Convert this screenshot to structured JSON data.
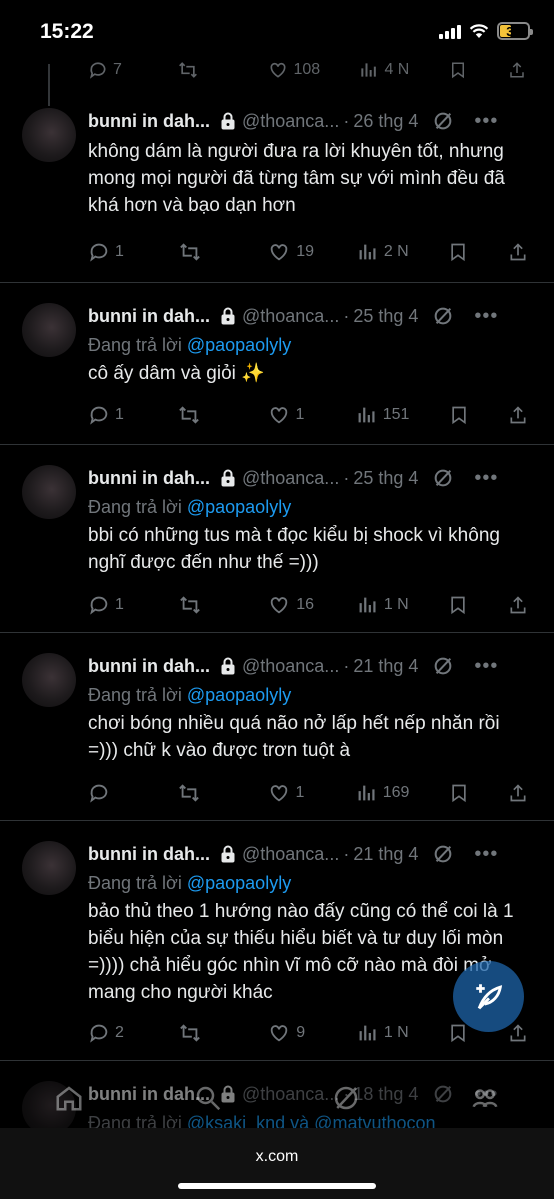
{
  "status": {
    "time": "15:22",
    "battery": "39"
  },
  "partial": {
    "reply_count": "7",
    "like_count": "108",
    "view_count": "4 N"
  },
  "tweets": [
    {
      "name": "bunni in dah...",
      "handle": "@thoanca...",
      "date": "26 thg 4",
      "reply_prefix": "",
      "mention": "",
      "text": "không dám là người đưa ra lời khuyên tốt, nhưng mong mọi người đã từng tâm sự với mình đều đã khá hơn và bạo dạn hơn",
      "replies": "1",
      "likes": "19",
      "views": "2 N"
    },
    {
      "name": "bunni in dah...",
      "handle": "@thoanca...",
      "date": "25 thg 4",
      "reply_prefix": "Đang trả lời",
      "mention": "@paopaolyly",
      "text": "cô ấy dâm và giỏi ✨",
      "replies": "1",
      "likes": "1",
      "views": "151"
    },
    {
      "name": "bunni in dah...",
      "handle": "@thoanca...",
      "date": "25 thg 4",
      "reply_prefix": "Đang trả lời",
      "mention": "@paopaolyly",
      "text": "bbi có những tus mà t đọc kiểu bị shock vì không nghĩ được đến như thế =)))",
      "replies": "1",
      "likes": "16",
      "views": "1 N"
    },
    {
      "name": "bunni in dah...",
      "handle": "@thoanca...",
      "date": "21 thg 4",
      "reply_prefix": "Đang trả lời",
      "mention": "@paopaolyly",
      "text": "chơi bóng nhiều quá não nở lấp hết nếp nhăn rồi =))) chữ k vào được trơn tuột à",
      "replies": "",
      "likes": "1",
      "views": "169"
    },
    {
      "name": "bunni in dah...",
      "handle": "@thoanca...",
      "date": "21 thg 4",
      "reply_prefix": "Đang trả lời",
      "mention": "@paopaolyly",
      "text": "bảo thủ theo 1 hướng nào đấy cũng có thể coi là 1 biểu hiện của sự thiếu hiểu biết và tư duy lối mòn =)))) chả hiểu góc nhìn vĩ mô cỡ nào mà đòi mở mang cho người khác",
      "replies": "2",
      "likes": "9",
      "views": "1 N"
    },
    {
      "name": "bunni in dah...",
      "handle": "@thoanca...",
      "date": "18 thg 4",
      "reply_prefix": "Đang trả lời",
      "mention": "@ksaki_knd và @matvuthocon",
      "text": "",
      "replies": "",
      "likes": "",
      "views": ""
    }
  ],
  "browser": {
    "url": "x.com"
  },
  "colors": {
    "link": "#1d9bf0",
    "muted": "#71767b",
    "fab": "#1d64aa"
  }
}
